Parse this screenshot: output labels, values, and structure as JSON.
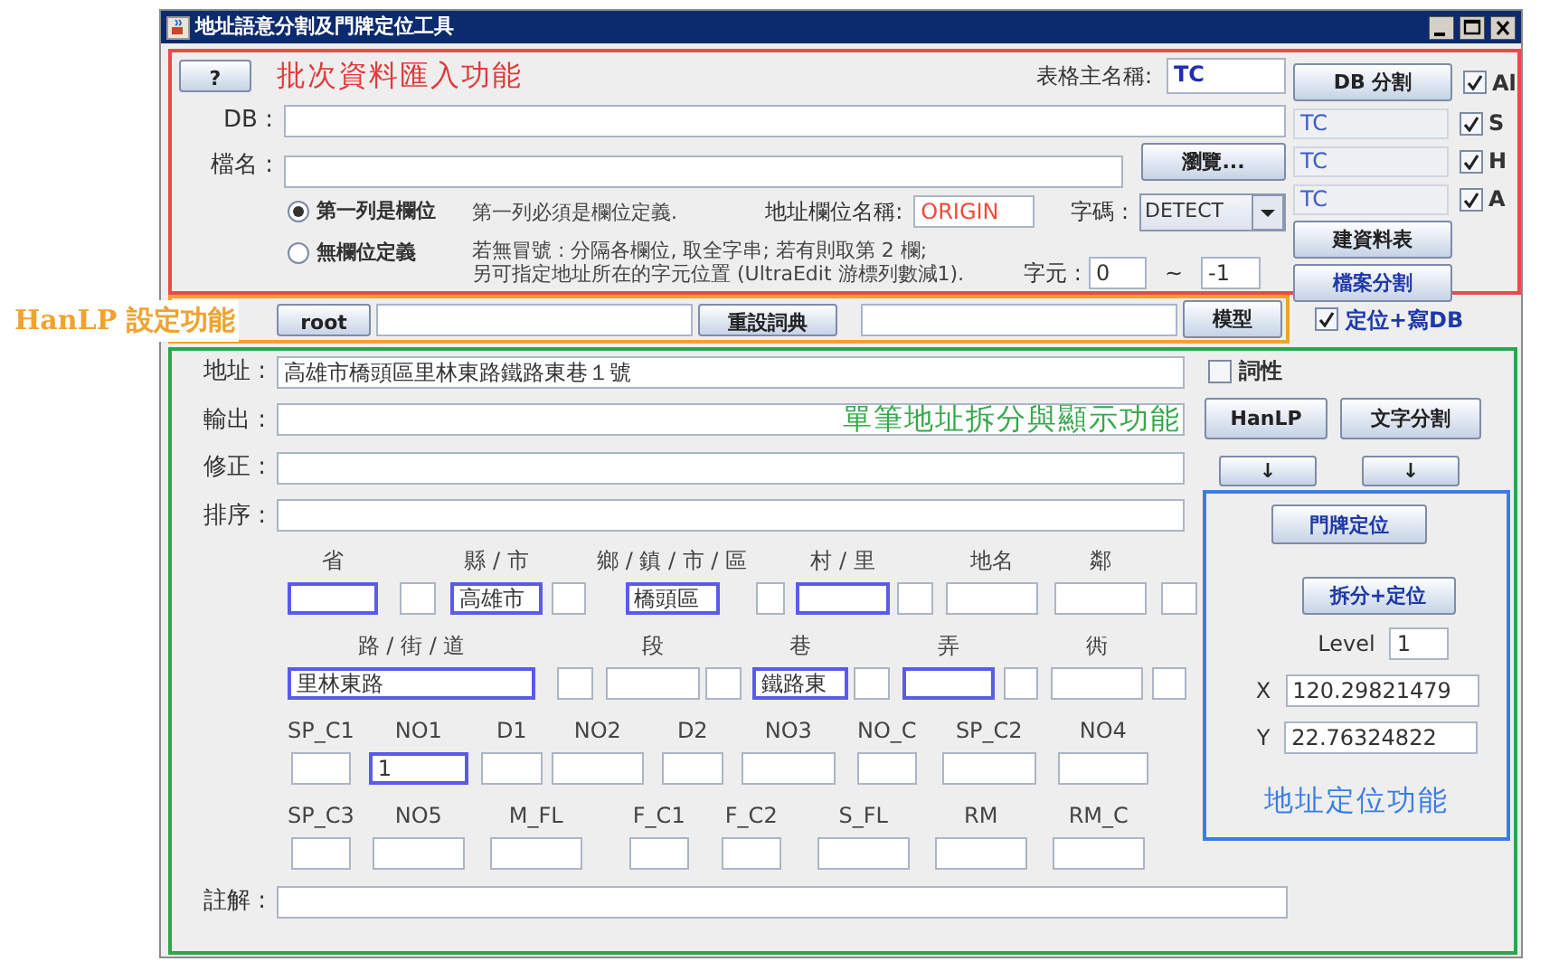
{
  "window": {
    "title": "地址語意分割及門牌定位工具"
  },
  "batch_import": {
    "help_button": "?",
    "annotation": "批次資料匯入功能",
    "table_name": {
      "label": "表格主名稱:",
      "value": "TC"
    },
    "db": {
      "label": "DB :"
    },
    "file": {
      "label": "檔名 :"
    },
    "browse_button": "瀏覽...",
    "header_modes": [
      {
        "label": "第一列是欄位",
        "selected": true,
        "notes": [
          "第一列必須是欄位定義."
        ]
      },
      {
        "label": "無欄位定義",
        "selected": false,
        "notes": [
          "若無冒號 : 分隔各欄位, 取全字串; 若有則取第 2 欄;",
          "另可指定地址所在的字元位置 (UltraEdit 游標列數減1)."
        ]
      }
    ],
    "address_column": {
      "label": "地址欄位名稱:",
      "value": "ORIGIN"
    },
    "encoding": {
      "label": "字碼 :",
      "value": "DETECT"
    },
    "char_range": {
      "label": "字元 :",
      "from": "0",
      "separator": "~",
      "to": "-1"
    }
  },
  "db_panel": {
    "rows": [
      {
        "kind": "button",
        "text": "DB 分割",
        "flag": {
          "label": "Al",
          "checked": true
        }
      },
      {
        "kind": "table",
        "value": "TC",
        "flag": {
          "label": "S",
          "checked": true
        }
      },
      {
        "kind": "table",
        "value": "TC",
        "flag": {
          "label": "H",
          "checked": true
        }
      },
      {
        "kind": "table",
        "value": "TC",
        "flag": {
          "label": "A",
          "checked": true
        }
      },
      {
        "kind": "button",
        "text": "建資料表"
      },
      {
        "kind": "button",
        "text": "檔案分割"
      }
    ]
  },
  "hanlp": {
    "annotation": "HanLP 設定功能",
    "root_button": "root",
    "dictionary_button": "重設詞典",
    "model_button": "模型"
  },
  "locate_write_db": {
    "label": "定位+寫DB",
    "checked": true
  },
  "single_address": {
    "annotation": "單筆地址拆分與顯示功能",
    "lines": [
      {
        "label": "地址 :",
        "value": "高雄市橋頭區里林東路鐵路東巷１號"
      },
      {
        "label": "輸出 :"
      },
      {
        "label": "修正 :"
      },
      {
        "label": "排序 :"
      }
    ],
    "pos_tag": {
      "label": "詞性",
      "checked": false
    },
    "hanlp_button": "HanLP",
    "text_split_button": "文字分割",
    "arrow_buttons": [
      "↓",
      "↓"
    ],
    "component_rows": [
      {
        "cells": [
          {
            "label": "省",
            "highlighted": true
          },
          {
            "highlighted": false
          },
          {
            "label": "縣 / 市",
            "value": "高雄市",
            "highlighted": true
          },
          {
            "highlighted": false
          },
          {
            "label": "鄉 / 鎮 / 市 / 區",
            "value": "橋頭區",
            "highlighted": true
          },
          {
            "highlighted": false
          },
          {
            "label": "村 / 里",
            "highlighted": true
          },
          {
            "highlighted": false
          },
          {
            "label": "地名",
            "highlighted": false
          },
          {
            "label": "鄰",
            "highlighted": false
          },
          {
            "highlighted": false
          }
        ]
      },
      {
        "cells": [
          {
            "label": "路 / 街 / 道",
            "value": "里林東路",
            "highlighted": true
          },
          {
            "highlighted": false
          },
          {
            "label": "段",
            "highlighted": false
          },
          {
            "highlighted": false
          },
          {
            "label": "巷",
            "value": "鐵路東",
            "highlighted": true
          },
          {
            "highlighted": false
          },
          {
            "label": "弄",
            "highlighted": true
          },
          {
            "highlighted": false
          },
          {
            "label": "衖",
            "highlighted": false
          },
          {
            "highlighted": false
          }
        ]
      },
      {
        "cells": [
          {
            "label": "SP_C1",
            "highlighted": false
          },
          {
            "label": "NO1",
            "value": "1",
            "highlighted": true
          },
          {
            "label": "D1",
            "highlighted": false
          },
          {
            "label": "NO2",
            "highlighted": false
          },
          {
            "label": "D2",
            "highlighted": false
          },
          {
            "label": "NO3",
            "highlighted": false
          },
          {
            "label": "NO_C",
            "highlighted": false
          },
          {
            "label": "SP_C2",
            "highlighted": false
          },
          {
            "label": "NO4",
            "highlighted": false
          }
        ]
      },
      {
        "cells": [
          {
            "label": "SP_C3",
            "highlighted": false
          },
          {
            "label": "NO5",
            "highlighted": false
          },
          {
            "label": "M_FL",
            "highlighted": false
          },
          {
            "label": "F_C1",
            "highlighted": false
          },
          {
            "label": "F_C2",
            "highlighted": false
          },
          {
            "label": "S_FL",
            "highlighted": false
          },
          {
            "label": "RM",
            "highlighted": false
          },
          {
            "label": "RM_C",
            "highlighted": false
          }
        ]
      }
    ],
    "remark": {
      "label": "註解 :"
    }
  },
  "geocode": {
    "door_button": "門牌定位",
    "split_locate_button": "拆分+定位",
    "level": {
      "label": "Level",
      "value": "1"
    },
    "x": {
      "label": "X",
      "value": "120.29821479"
    },
    "y": {
      "label": "Y",
      "value": "22.76324822"
    },
    "annotation": "地址定位功能"
  }
}
